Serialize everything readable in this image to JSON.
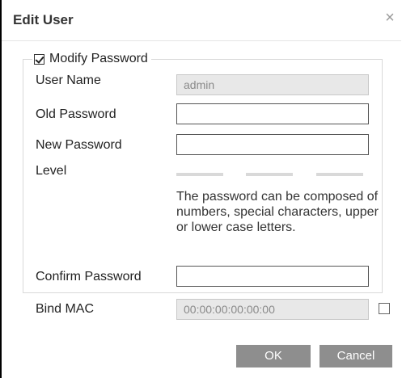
{
  "dialog": {
    "title": "Edit User",
    "close_glyph": "×",
    "close_icon": "close-icon"
  },
  "modify_password": {
    "label": "Modify Password",
    "checked": true
  },
  "fields": {
    "user_name": {
      "label": "User Name",
      "value": "admin",
      "disabled": true
    },
    "old_password": {
      "label": "Old Password",
      "value": ""
    },
    "new_password": {
      "label": "New Password",
      "value": ""
    },
    "level": {
      "label": "Level"
    },
    "confirm_password": {
      "label": "Confirm Password",
      "value": ""
    },
    "bind_mac": {
      "label": "Bind MAC",
      "value": "00:00:00:00:00:00",
      "disabled": true,
      "checked": false
    }
  },
  "hint": "The password can be composed of numbers, special characters, upper or lower case letters.",
  "buttons": {
    "ok": "OK",
    "cancel": "Cancel"
  },
  "colors": {
    "button_bg": "#8e8e8e",
    "disabled_input_bg": "#e8e8e8",
    "level_bar": "#d9d9d9"
  }
}
